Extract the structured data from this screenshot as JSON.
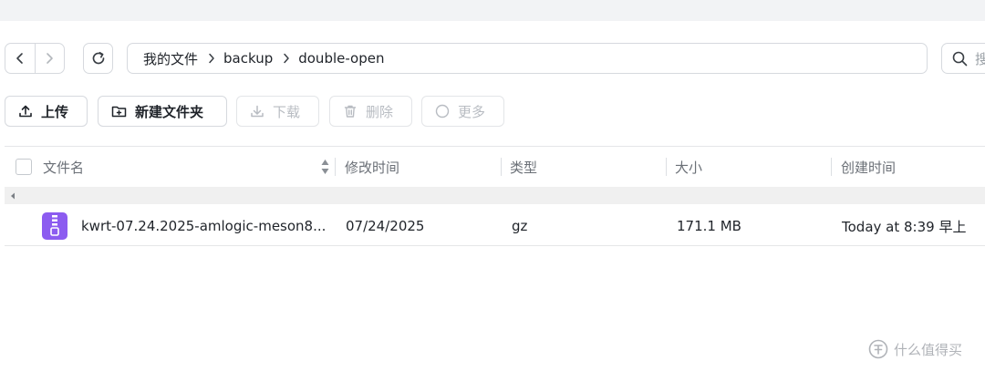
{
  "navigation": {
    "back_icon": "chevron-left-icon",
    "forward_icon": "chevron-right-icon",
    "refresh_icon": "refresh-icon"
  },
  "breadcrumb": [
    "我的文件",
    "backup",
    "double-open"
  ],
  "search": {
    "placeholder": "搜"
  },
  "toolbar": {
    "upload": "上传",
    "new_folder": "新建文件夹",
    "download": "下载",
    "delete": "删除",
    "more": "更多"
  },
  "table": {
    "columns": {
      "name": "文件名",
      "modified": "修改时间",
      "type": "类型",
      "size": "大小",
      "created": "创建时间"
    },
    "rows": [
      {
        "icon": "archive-file-icon",
        "name": "kwrt-07.24.2025-amlogic-meson8...",
        "modified": "07/24/2025",
        "type": "gz",
        "size": "171.1 MB",
        "created": "Today at 8:39 早上"
      }
    ]
  },
  "watermark": {
    "text": "什么值得买"
  },
  "colors": {
    "archive_icon": "#8c5cf0",
    "border": "#d6d9de",
    "disabled_text": "#b8bcc2"
  }
}
